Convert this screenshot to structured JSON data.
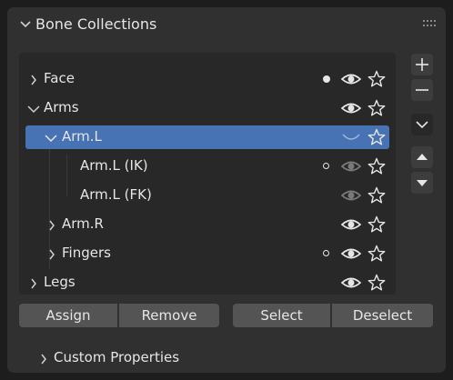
{
  "panel": {
    "title": "Bone Collections"
  },
  "tree": [
    {
      "label": "Face",
      "expanded": false,
      "dot": "filled",
      "eye": "visible",
      "star": true
    },
    {
      "label": "Arms",
      "expanded": true,
      "dot": "none",
      "eye": "visible",
      "star": true
    },
    {
      "label": "Arm.L",
      "expanded": true,
      "selected": true,
      "dot": "none",
      "eye": "hidden",
      "star": true
    },
    {
      "label": "Arm.L (IK)",
      "dot": "hollow",
      "eye": "dim",
      "star": true
    },
    {
      "label": "Arm.L (FK)",
      "dot": "none",
      "eye": "dim",
      "star": true
    },
    {
      "label": "Arm.R",
      "expanded": false,
      "dot": "none",
      "eye": "visible",
      "star": true
    },
    {
      "label": "Fingers",
      "expanded": false,
      "dot": "hollow",
      "eye": "visible",
      "star": true
    },
    {
      "label": "Legs",
      "expanded": false,
      "dot": "none",
      "eye": "visible",
      "star": true
    }
  ],
  "side_buttons": [
    "plus-icon",
    "minus-icon",
    "chevron-down-icon",
    "triangle-up-icon",
    "triangle-down-icon"
  ],
  "buttons": {
    "assign": "Assign",
    "remove": "Remove",
    "select": "Select",
    "deselect": "Deselect"
  },
  "subpanel": {
    "title": "Custom Properties"
  },
  "colors": {
    "selection": "#4772b3",
    "panel": "#303030",
    "list": "#282828",
    "button": "#545454"
  }
}
